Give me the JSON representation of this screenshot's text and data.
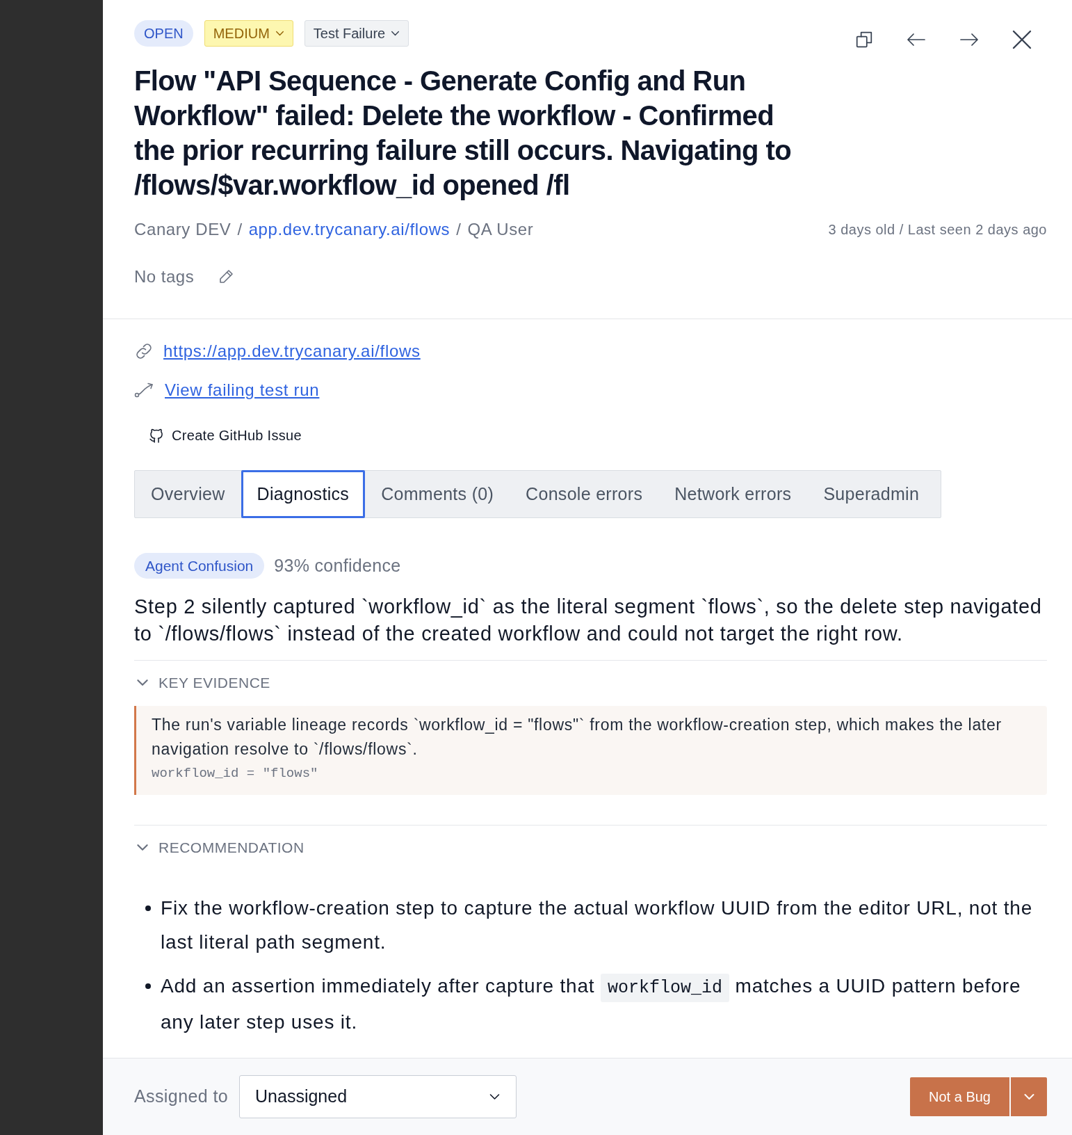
{
  "header": {
    "badges": [
      {
        "kind": "status",
        "label": "OPEN"
      },
      {
        "kind": "severity",
        "label": "MEDIUM"
      },
      {
        "kind": "type",
        "label": "Test Failure"
      }
    ],
    "title": "Flow \"API Sequence - Generate Config and Run Workflow\" failed: Delete the workflow - Confirmed the prior recurring failure still occurs. Navigating to /flows/$var.workflow_id opened /fl",
    "breadcrumb": [
      {
        "kind": "text",
        "text": "Canary DEV"
      },
      {
        "kind": "separator",
        "text": "/"
      },
      {
        "kind": "link",
        "text": "app.dev.trycanary.ai/flows"
      },
      {
        "kind": "separator",
        "text": "/"
      },
      {
        "kind": "text",
        "text": "QA User"
      }
    ],
    "age": "3 days old / Last seen 2 days ago",
    "tags": "No tags"
  },
  "links": [
    {
      "kind": "url",
      "text": "https://app.dev.trycanary.ai/flows"
    },
    {
      "kind": "test_run",
      "text": "View failing test run"
    }
  ],
  "github_action": "Create GitHub Issue",
  "tabs": [
    {
      "label": "Overview",
      "selected": false
    },
    {
      "label": "Diagnostics",
      "selected": true
    },
    {
      "label": "Comments (0)",
      "selected": false
    },
    {
      "label": "Console errors",
      "selected": false
    },
    {
      "label": "Network errors",
      "selected": false
    },
    {
      "label": "Superadmin",
      "selected": false
    }
  ],
  "diagnostics": {
    "category": "Agent Confusion",
    "confidence": "93% confidence",
    "summary": "Step 2 silently captured `workflow_id` as the literal segment `flows`, so the delete step navigated to `/flows/flows` instead of the created workflow and could not target the right row.",
    "sections": [
      {
        "kind": "evidence",
        "title": "KEY EVIDENCE",
        "expanded": true,
        "quote": "The run's variable lineage records `workflow_id = \"flows\"` from the workflow-creation step, which makes the later navigation resolve to `/flows/flows`.",
        "code": "workflow_id = \"flows\""
      },
      {
        "kind": "recommendation",
        "title": "RECOMMENDATION",
        "expanded": true,
        "items": [
          {
            "parts": [
              {
                "kind": "text",
                "text": "Fix the workflow-creation step to capture the actual workflow UUID from the editor URL, not the last literal path segment."
              }
            ]
          },
          {
            "parts": [
              {
                "kind": "text",
                "text": "Add an assertion immediately after capture that "
              },
              {
                "kind": "code",
                "text": "workflow_id"
              },
              {
                "kind": "text",
                "text": " matches a UUID pattern before any later step uses it."
              }
            ]
          }
        ]
      }
    ]
  },
  "footer": {
    "assigned_label": "Assigned to",
    "assignee": "Unassigned",
    "action": "Not a Bug"
  }
}
